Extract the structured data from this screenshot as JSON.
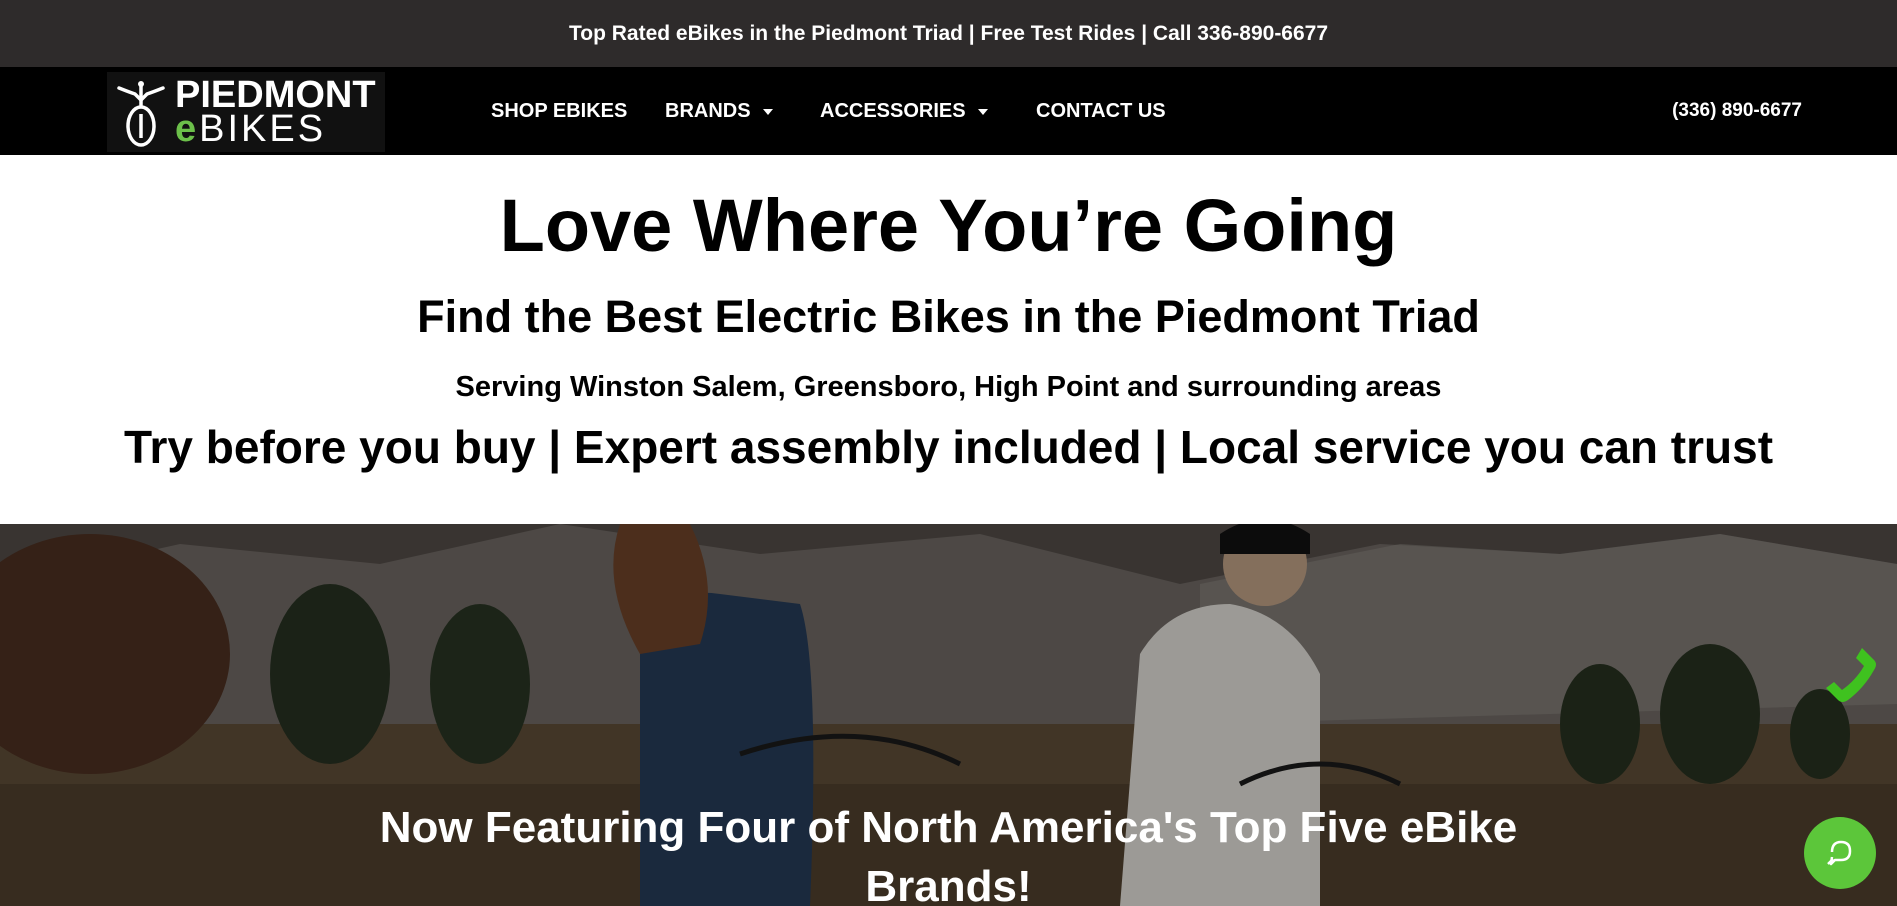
{
  "topbar": {
    "text": "Top Rated eBikes in the Piedmont Triad | Free Test Rides | Call 336-890-6677"
  },
  "logo": {
    "line1": "PIEDMONT",
    "line2_prefix": "e",
    "line2_rest": "BIKES"
  },
  "nav": {
    "items": [
      {
        "label": "SHOP EBIKES",
        "has_dropdown": false
      },
      {
        "label": "BRANDS",
        "has_dropdown": true
      },
      {
        "label": "ACCESSORIES",
        "has_dropdown": true
      },
      {
        "label": "CONTACT US",
        "has_dropdown": false
      }
    ],
    "phone": "(336) 890-6677"
  },
  "hero": {
    "title": "Love Where You’re Going",
    "subtitle": "Find the Best Electric Bikes in the Piedmont Triad",
    "service_area": "Serving Winston Salem, Greensboro, High Point and surrounding areas",
    "tagline": "Try before you buy | Expert assembly included | Local service you can trust"
  },
  "featured": {
    "heading": "Now Featuring Four of North America's Top Five eBike Brands!"
  },
  "floating": {
    "phone_icon": "phone-icon",
    "chat_icon": "chat-icon"
  },
  "colors": {
    "topbar_bg": "#2e2b2b",
    "nav_bg": "#000000",
    "accent_green": "#5cc63a"
  }
}
